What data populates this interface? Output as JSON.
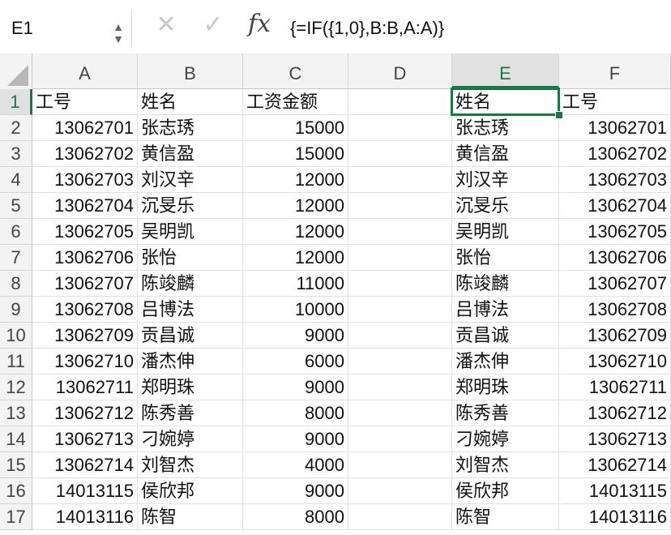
{
  "name_box": {
    "value": "E1"
  },
  "formula_bar": {
    "cancel_symbol": "✕",
    "enter_symbol": "✓",
    "fx_label": "fx",
    "formula": "{=IF({1,0},B:B,A:A)}"
  },
  "columns": [
    "A",
    "B",
    "C",
    "D",
    "E",
    "F"
  ],
  "selected_column": "E",
  "selected_row": 1,
  "rows": [
    {
      "n": "1",
      "a": "工号",
      "b": "姓名",
      "c": "工资金额",
      "d": "",
      "e": "姓名",
      "f": "工号"
    },
    {
      "n": "2",
      "a": "13062701",
      "b": "张志琇",
      "c": "15000",
      "d": "",
      "e": "张志琇",
      "f": "13062701"
    },
    {
      "n": "3",
      "a": "13062702",
      "b": "黄信盈",
      "c": "15000",
      "d": "",
      "e": "黄信盈",
      "f": "13062702"
    },
    {
      "n": "4",
      "a": "13062703",
      "b": "刘汉辛",
      "c": "12000",
      "d": "",
      "e": "刘汉辛",
      "f": "13062703"
    },
    {
      "n": "5",
      "a": "13062704",
      "b": "沉旻乐",
      "c": "12000",
      "d": "",
      "e": "沉旻乐",
      "f": "13062704"
    },
    {
      "n": "6",
      "a": "13062705",
      "b": "吴明凯",
      "c": "12000",
      "d": "",
      "e": "吴明凯",
      "f": "13062705"
    },
    {
      "n": "7",
      "a": "13062706",
      "b": "张怡",
      "c": "12000",
      "d": "",
      "e": "张怡",
      "f": "13062706"
    },
    {
      "n": "8",
      "a": "13062707",
      "b": "陈竣麟",
      "c": "11000",
      "d": "",
      "e": "陈竣麟",
      "f": "13062707"
    },
    {
      "n": "9",
      "a": "13062708",
      "b": "吕博法",
      "c": "10000",
      "d": "",
      "e": "吕博法",
      "f": "13062708"
    },
    {
      "n": "10",
      "a": "13062709",
      "b": "贡昌诚",
      "c": "9000",
      "d": "",
      "e": "贡昌诚",
      "f": "13062709"
    },
    {
      "n": "11",
      "a": "13062710",
      "b": "潘杰伸",
      "c": "6000",
      "d": "",
      "e": "潘杰伸",
      "f": "13062710"
    },
    {
      "n": "12",
      "a": "13062711",
      "b": "郑明珠",
      "c": "9000",
      "d": "",
      "e": "郑明珠",
      "f": "13062711"
    },
    {
      "n": "13",
      "a": "13062712",
      "b": "陈秀善",
      "c": "8000",
      "d": "",
      "e": "陈秀善",
      "f": "13062712"
    },
    {
      "n": "14",
      "a": "13062713",
      "b": "刁婉婷",
      "c": "9000",
      "d": "",
      "e": "刁婉婷",
      "f": "13062713"
    },
    {
      "n": "15",
      "a": "13062714",
      "b": "刘智杰",
      "c": "4000",
      "d": "",
      "e": "刘智杰",
      "f": "13062714"
    },
    {
      "n": "16",
      "a": "14013115",
      "b": "侯欣邦",
      "c": "9000",
      "d": "",
      "e": "侯欣邦",
      "f": "14013115"
    },
    {
      "n": "17",
      "a": "14013116",
      "b": "陈智",
      "c": "8000",
      "d": "",
      "e": "陈智",
      "f": "14013116"
    }
  ]
}
